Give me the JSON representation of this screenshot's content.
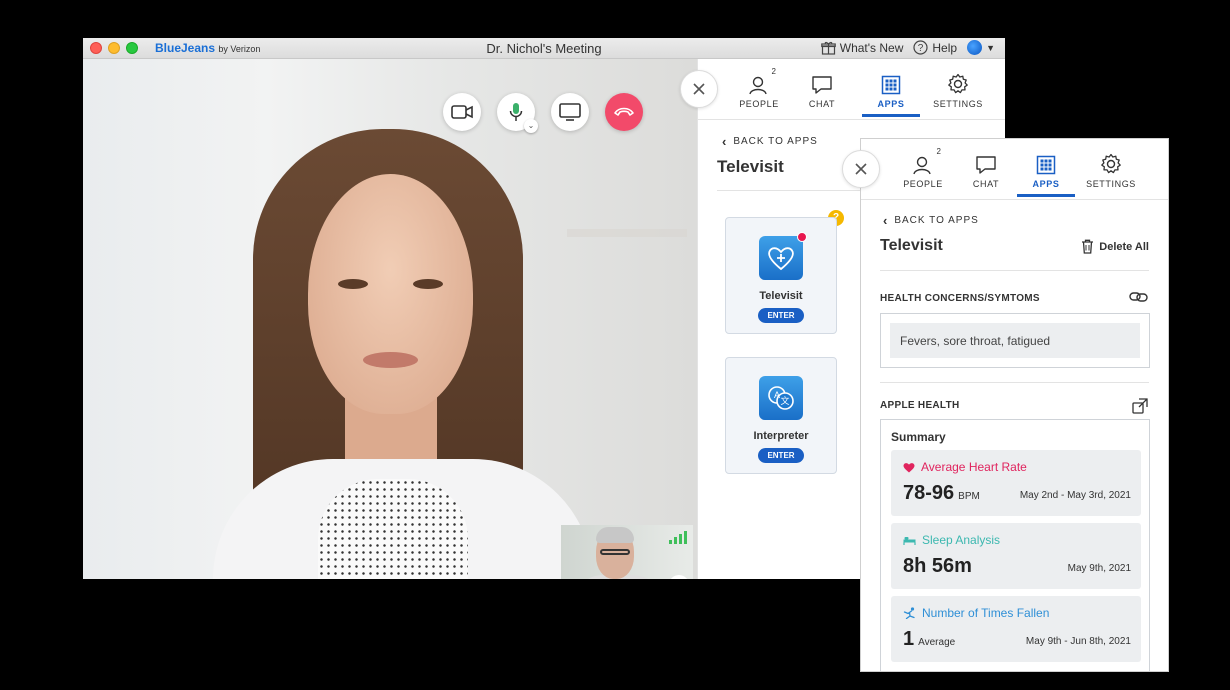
{
  "window": {
    "title": "Dr. Nichol's Meeting",
    "brand": "BlueJeans",
    "brand_by": "by Verizon",
    "whats_new": "What's New",
    "help": "Help"
  },
  "tabs": {
    "people": "PEOPLE",
    "people_count": "2",
    "chat": "CHAT",
    "apps": "APPS",
    "settings": "SETTINGS"
  },
  "panel": {
    "back": "BACK TO APPS",
    "title": "Televisit",
    "apps": [
      {
        "name": "Televisit",
        "button": "ENTER"
      },
      {
        "name": "Interpreter",
        "button": "ENTER"
      }
    ],
    "help_badge": "?"
  },
  "overlay": {
    "back": "BACK TO APPS",
    "title": "Televisit",
    "delete_all": "Delete All",
    "health_header": "HEALTH CONCERNS/SYMTOMS",
    "symptoms": "Fevers, sore throat, fatigued",
    "apple_header": "APPLE HEALTH",
    "summary_title": "Summary",
    "metrics": [
      {
        "name": "Average Heart Rate",
        "value": "78-96",
        "unit": "BPM",
        "date": "May 2nd - May 3rd, 2021",
        "color": "#e0245e",
        "icon": "heart-icon"
      },
      {
        "name": "Sleep Analysis",
        "value": "8h 56m",
        "unit": "",
        "date": "May 9th, 2021",
        "color": "#3cb8b0",
        "icon": "bed-icon"
      },
      {
        "name": "Number of Times Fallen",
        "value": "1",
        "unit": "Average",
        "date": "May 9th - Jun 8th, 2021",
        "color": "#2f8fd6",
        "icon": "fall-icon"
      }
    ]
  },
  "colors": {
    "accent": "#1a5fc4",
    "end_call": "#f24a6a"
  }
}
